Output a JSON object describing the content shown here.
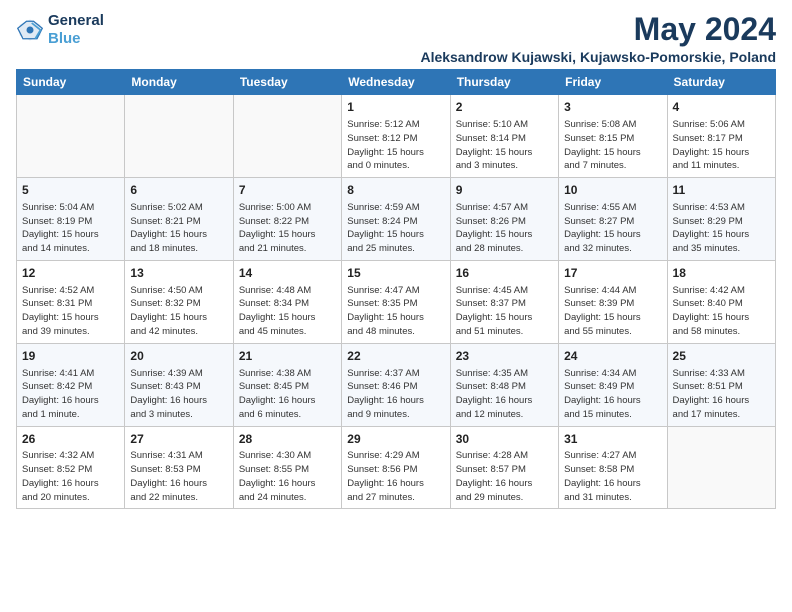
{
  "logo": {
    "line1": "General",
    "line2": "Blue"
  },
  "title": "May 2024",
  "subtitle": "Aleksandrow Kujawski, Kujawsko-Pomorskie, Poland",
  "days_of_week": [
    "Sunday",
    "Monday",
    "Tuesday",
    "Wednesday",
    "Thursday",
    "Friday",
    "Saturday"
  ],
  "weeks": [
    [
      {
        "day": "",
        "info": ""
      },
      {
        "day": "",
        "info": ""
      },
      {
        "day": "",
        "info": ""
      },
      {
        "day": "1",
        "info": "Sunrise: 5:12 AM\nSunset: 8:12 PM\nDaylight: 15 hours\nand 0 minutes."
      },
      {
        "day": "2",
        "info": "Sunrise: 5:10 AM\nSunset: 8:14 PM\nDaylight: 15 hours\nand 3 minutes."
      },
      {
        "day": "3",
        "info": "Sunrise: 5:08 AM\nSunset: 8:15 PM\nDaylight: 15 hours\nand 7 minutes."
      },
      {
        "day": "4",
        "info": "Sunrise: 5:06 AM\nSunset: 8:17 PM\nDaylight: 15 hours\nand 11 minutes."
      }
    ],
    [
      {
        "day": "5",
        "info": "Sunrise: 5:04 AM\nSunset: 8:19 PM\nDaylight: 15 hours\nand 14 minutes."
      },
      {
        "day": "6",
        "info": "Sunrise: 5:02 AM\nSunset: 8:21 PM\nDaylight: 15 hours\nand 18 minutes."
      },
      {
        "day": "7",
        "info": "Sunrise: 5:00 AM\nSunset: 8:22 PM\nDaylight: 15 hours\nand 21 minutes."
      },
      {
        "day": "8",
        "info": "Sunrise: 4:59 AM\nSunset: 8:24 PM\nDaylight: 15 hours\nand 25 minutes."
      },
      {
        "day": "9",
        "info": "Sunrise: 4:57 AM\nSunset: 8:26 PM\nDaylight: 15 hours\nand 28 minutes."
      },
      {
        "day": "10",
        "info": "Sunrise: 4:55 AM\nSunset: 8:27 PM\nDaylight: 15 hours\nand 32 minutes."
      },
      {
        "day": "11",
        "info": "Sunrise: 4:53 AM\nSunset: 8:29 PM\nDaylight: 15 hours\nand 35 minutes."
      }
    ],
    [
      {
        "day": "12",
        "info": "Sunrise: 4:52 AM\nSunset: 8:31 PM\nDaylight: 15 hours\nand 39 minutes."
      },
      {
        "day": "13",
        "info": "Sunrise: 4:50 AM\nSunset: 8:32 PM\nDaylight: 15 hours\nand 42 minutes."
      },
      {
        "day": "14",
        "info": "Sunrise: 4:48 AM\nSunset: 8:34 PM\nDaylight: 15 hours\nand 45 minutes."
      },
      {
        "day": "15",
        "info": "Sunrise: 4:47 AM\nSunset: 8:35 PM\nDaylight: 15 hours\nand 48 minutes."
      },
      {
        "day": "16",
        "info": "Sunrise: 4:45 AM\nSunset: 8:37 PM\nDaylight: 15 hours\nand 51 minutes."
      },
      {
        "day": "17",
        "info": "Sunrise: 4:44 AM\nSunset: 8:39 PM\nDaylight: 15 hours\nand 55 minutes."
      },
      {
        "day": "18",
        "info": "Sunrise: 4:42 AM\nSunset: 8:40 PM\nDaylight: 15 hours\nand 58 minutes."
      }
    ],
    [
      {
        "day": "19",
        "info": "Sunrise: 4:41 AM\nSunset: 8:42 PM\nDaylight: 16 hours\nand 1 minute."
      },
      {
        "day": "20",
        "info": "Sunrise: 4:39 AM\nSunset: 8:43 PM\nDaylight: 16 hours\nand 3 minutes."
      },
      {
        "day": "21",
        "info": "Sunrise: 4:38 AM\nSunset: 8:45 PM\nDaylight: 16 hours\nand 6 minutes."
      },
      {
        "day": "22",
        "info": "Sunrise: 4:37 AM\nSunset: 8:46 PM\nDaylight: 16 hours\nand 9 minutes."
      },
      {
        "day": "23",
        "info": "Sunrise: 4:35 AM\nSunset: 8:48 PM\nDaylight: 16 hours\nand 12 minutes."
      },
      {
        "day": "24",
        "info": "Sunrise: 4:34 AM\nSunset: 8:49 PM\nDaylight: 16 hours\nand 15 minutes."
      },
      {
        "day": "25",
        "info": "Sunrise: 4:33 AM\nSunset: 8:51 PM\nDaylight: 16 hours\nand 17 minutes."
      }
    ],
    [
      {
        "day": "26",
        "info": "Sunrise: 4:32 AM\nSunset: 8:52 PM\nDaylight: 16 hours\nand 20 minutes."
      },
      {
        "day": "27",
        "info": "Sunrise: 4:31 AM\nSunset: 8:53 PM\nDaylight: 16 hours\nand 22 minutes."
      },
      {
        "day": "28",
        "info": "Sunrise: 4:30 AM\nSunset: 8:55 PM\nDaylight: 16 hours\nand 24 minutes."
      },
      {
        "day": "29",
        "info": "Sunrise: 4:29 AM\nSunset: 8:56 PM\nDaylight: 16 hours\nand 27 minutes."
      },
      {
        "day": "30",
        "info": "Sunrise: 4:28 AM\nSunset: 8:57 PM\nDaylight: 16 hours\nand 29 minutes."
      },
      {
        "day": "31",
        "info": "Sunrise: 4:27 AM\nSunset: 8:58 PM\nDaylight: 16 hours\nand 31 minutes."
      },
      {
        "day": "",
        "info": ""
      }
    ]
  ]
}
